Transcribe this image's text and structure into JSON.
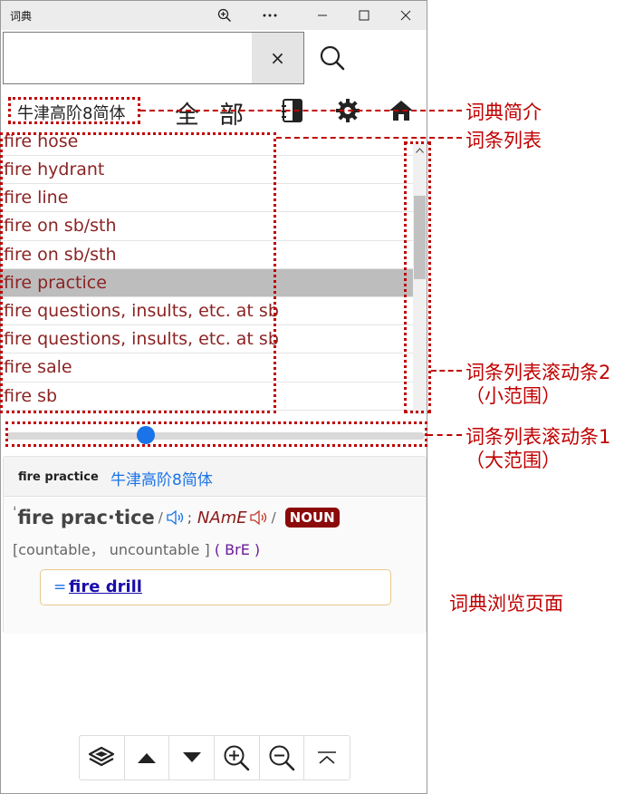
{
  "window": {
    "title": "词典",
    "controls": [
      "zoom-icon",
      "more-icon",
      "minimize-icon",
      "maximize-icon",
      "close-icon"
    ]
  },
  "search": {
    "value": "",
    "placeholder": "",
    "clear_label": "×"
  },
  "toolbar": {
    "dict_name": "牛津高阶8简体",
    "all_label": "全部"
  },
  "word_list": {
    "items": [
      "fire hose",
      "fire hydrant",
      "fire line",
      "fire on sb/sth",
      "fire on sb/sth",
      "fire practice",
      "fire questions, insults, etc. at sb",
      "fire questions, insults, etc. at sb",
      "fire sale",
      "fire sb"
    ],
    "selected_index": 5,
    "vertical_scroll_fraction": 0.2,
    "horizontal_slider_fraction": 0.33
  },
  "viewer": {
    "header_word": "fire practice",
    "header_dict": "牛津高阶8简体",
    "stress_mark": "ˈ",
    "headword": "fire prac·tice",
    "slash": "/",
    "semicolon": ";",
    "region_label": "NAmE",
    "pos": "NOUN",
    "grammar": "[countable， uncountable ]",
    "region_note": "( BrE )",
    "xref_prefix": "=",
    "xref_word": "fire drill"
  },
  "bottom_nav": [
    "layers-icon",
    "up-arrow-icon",
    "down-arrow-icon",
    "zoom-in-icon",
    "zoom-out-icon",
    "scroll-top-icon"
  ],
  "annotations": {
    "dict_intro": "词典简介",
    "word_list": "词条列表",
    "scrollbar2": "词条列表滚动条2",
    "scrollbar2_note": "（小范围）",
    "scrollbar1": "词条列表滚动条1",
    "scrollbar1_note": "（大范围）",
    "browse_page": "词典浏览页面"
  },
  "colors": {
    "accent": "#1a73e8",
    "annotation": "#c00000",
    "entry_text": "#8b2323",
    "noun_badge": "#8b0a0a"
  }
}
